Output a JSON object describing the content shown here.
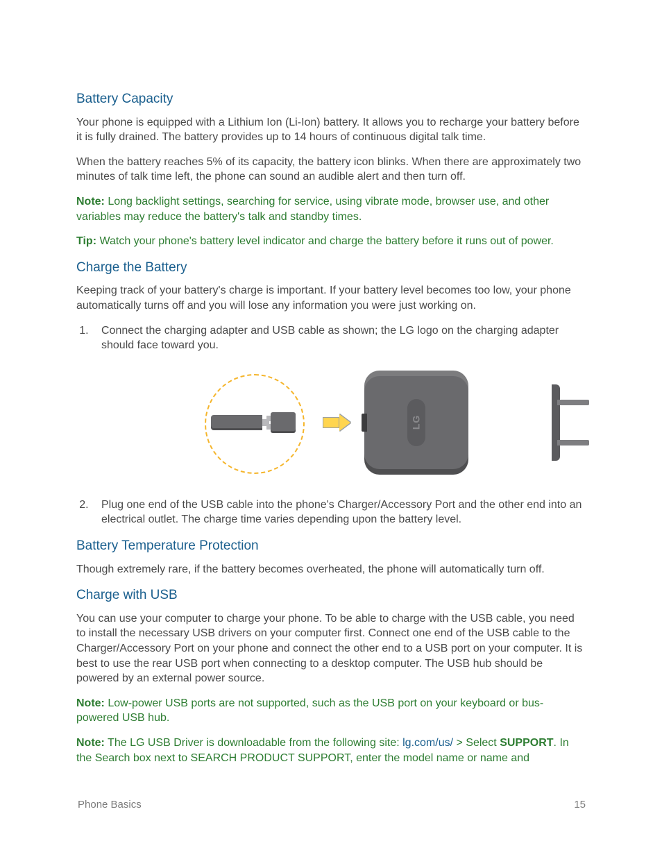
{
  "sections": {
    "battery_capacity": {
      "heading": "Battery Capacity",
      "p1": "Your phone is equipped with a Lithium Ion (Li-Ion) battery. It allows you to recharge your battery before it is fully drained. The battery provides up to 14 hours of continuous digital talk time.",
      "p2": "When the battery reaches 5% of its capacity, the battery icon blinks. When there are approximately two minutes of talk time left, the phone can sound an audible alert and then turn off.",
      "note_label": "Note:",
      "note_text": "Long backlight settings, searching for service, using vibrate mode, browser use, and other variables may reduce the battery's talk and standby times.",
      "tip_label": "Tip:",
      "tip_text": "Watch your phone's battery level indicator and charge the battery before it runs out of power."
    },
    "charge_battery": {
      "heading": "Charge the Battery",
      "p1": "Keeping track of your battery's charge is important. If your battery level becomes too low, your phone automatically turns off and you will lose any information you were just working on.",
      "step1": "Connect the charging adapter and USB cable as shown; the LG logo on the charging adapter should face toward you.",
      "step2": "Plug one end of the USB cable into the phone's Charger/Accessory Port and the other end into an electrical outlet. The charge time varies depending upon the battery level.",
      "logo_text": "LG"
    },
    "temp_protection": {
      "heading": "Battery Temperature Protection",
      "p1": "Though extremely rare, if the battery becomes overheated, the phone will automatically turn off."
    },
    "charge_usb": {
      "heading": "Charge with USB",
      "p1": "You can use your computer to charge your phone. To be able to charge with the USB cable, you need to install the necessary USB drivers on your computer first. Connect one end of the USB cable to the Charger/Accessory Port on your phone and connect the other end to a USB port on your computer. It is best to use the rear USB port when connecting to a desktop computer. The USB hub should be powered by an external power source.",
      "note1_label": "Note:",
      "note1_text": "Low-power USB ports are not supported, such as the USB port on your keyboard or bus-powered USB hub.",
      "note2_label": "Note:",
      "note2_pre": "The LG USB Driver is downloadable from the following site: ",
      "note2_link": "lg.com/us/",
      "note2_mid": " > Select ",
      "note2_bold": "SUPPORT",
      "note2_post": ". In the Search box next to SEARCH PRODUCT SUPPORT, enter the model name or name and"
    }
  },
  "footer": {
    "section": "Phone Basics",
    "page": "15"
  }
}
